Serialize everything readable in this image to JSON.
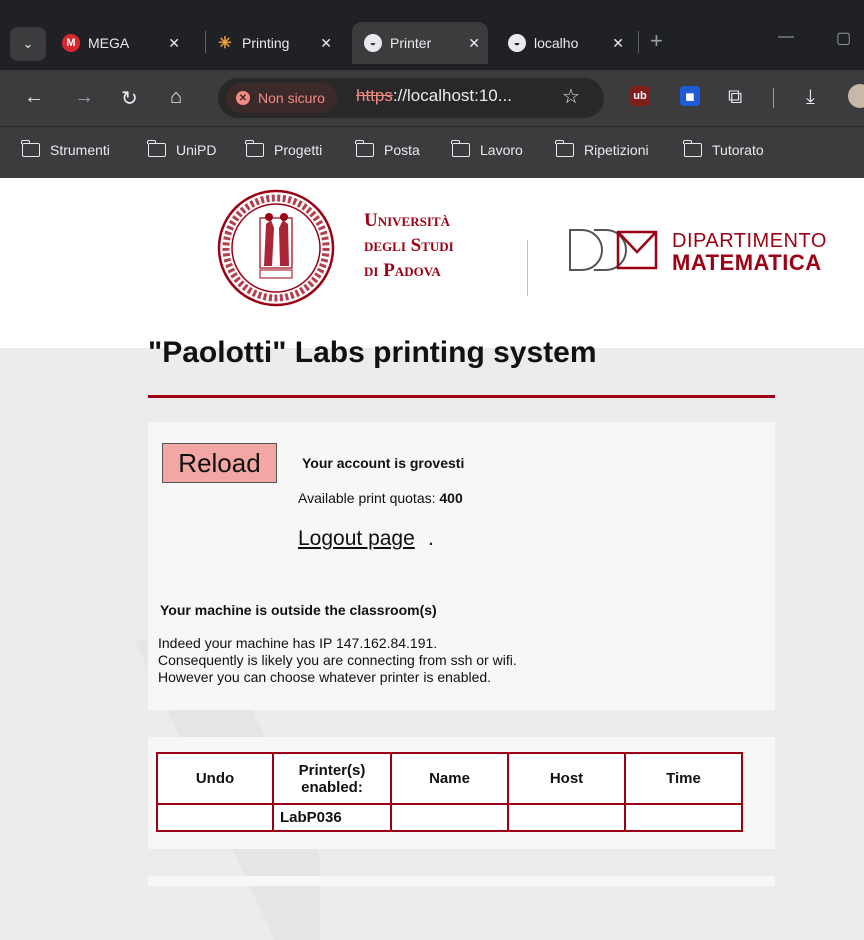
{
  "browser": {
    "tabs": [
      {
        "title": "MEGA",
        "icon": "mega-icon",
        "active": false
      },
      {
        "title": "Printing",
        "icon": "printing-icon",
        "active": false
      },
      {
        "title": "Printer",
        "icon": "globe-icon",
        "active": true
      },
      {
        "title": "localho",
        "icon": "globe-icon",
        "active": false
      }
    ],
    "security_chip": "Non sicuro",
    "url_scheme": "https",
    "url_rest": "://localhost:10...",
    "bookmarks": [
      "Strumenti",
      "UniPD",
      "Progetti",
      "Posta",
      "Lavoro",
      "Ripetizioni",
      "Tutorato"
    ]
  },
  "header": {
    "university_lines": [
      "Università",
      "degli Studi",
      "di Padova"
    ],
    "department_lines": [
      "DIPARTIMENTO",
      "MATEMATICA"
    ]
  },
  "page": {
    "title": "\"Paolotti\" Labs printing system",
    "reload_label": "Reload",
    "account_text": "Your account is grovesti",
    "quota_label": "Available print quotas: ",
    "quota_value": "400",
    "logout_label": "Logout page",
    "logout_suffix": ".",
    "outside_heading": "Your machine is outside the classroom(s)",
    "info_lines": [
      "Indeed your machine has IP 147.162.84.191.",
      "Consequently is likely you are connecting from ssh or wifi.",
      "However you can choose whatever printer is enabled."
    ]
  },
  "printers_table": {
    "headers": [
      "Undo",
      "Printer(s) enabled:",
      "Name",
      "Host",
      "Time"
    ],
    "rows": [
      [
        "",
        "LabP036",
        "",
        "",
        ""
      ]
    ]
  },
  "colors": {
    "brand": "#9b0014",
    "reload_bg": "#f2a7a5"
  }
}
